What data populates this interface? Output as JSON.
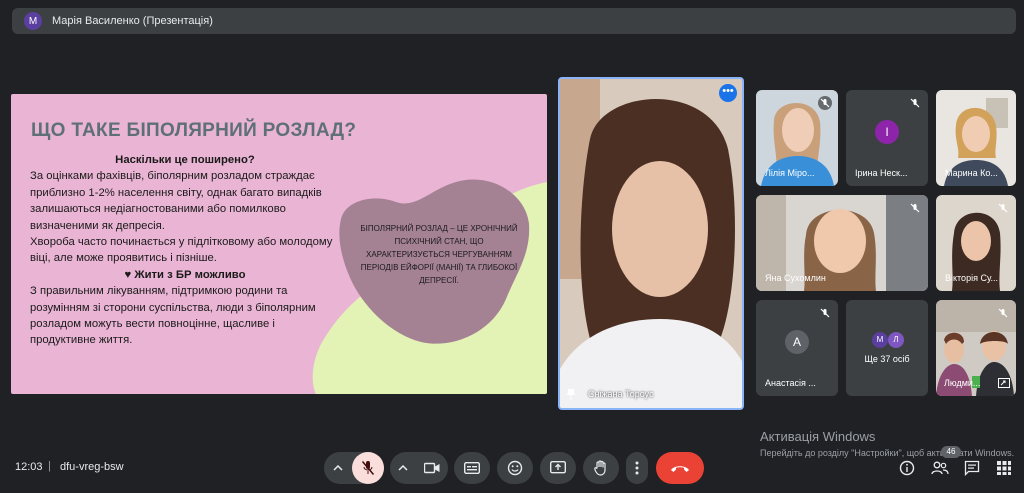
{
  "presenter": {
    "avatar_letter": "M",
    "title": "Марія Василенко (Презентація)"
  },
  "slide": {
    "title": "ЩО ТАКЕ БІПОЛЯРНИЙ РОЗЛАД?",
    "subtitle": "Наскільки це поширено?",
    "p1": "За оцінками фахівців, біполярним розладом страждає приблизно 1-2% населення світу, однак багато випадків залишаються недіагностованими або помилково визначеними як депресія.",
    "p2": "Хвороба часто починається у підлітковому або молодому віці, але може проявитись і пізніше.",
    "heading2": "♥ Жити з БР можливо",
    "p3": "З правильним лікуванням, підтримкою родини та розумінням зі сторони суспільства, люди з біполярним розладом можуть вести повноцінне, щасливе і продуктивне життя.",
    "blob_text": "Біполярний розлад – це хронічний психічний стан, що характеризується чергуванням періодів ейфорії (манії) та глибокої депресії."
  },
  "main_video": {
    "name": "Сніжана Тороус"
  },
  "tiles": {
    "t1": {
      "name": "Лілія Міро..."
    },
    "t2": {
      "name": "Ірина Неск...",
      "letter": "І"
    },
    "t3": {
      "name": "Марина Ко..."
    },
    "t4": {
      "name": "Яна Сухомлин"
    },
    "t5": {
      "name": "Вікторія Су..."
    },
    "t6": {
      "name": "Анастасія ...",
      "letter": "A"
    },
    "t7": {
      "name": "Ще 37 осіб",
      "letters": [
        "M",
        "Л"
      ]
    },
    "t8": {
      "name": "Людми..."
    }
  },
  "activation": {
    "title": "Активація Windows",
    "sub": "Перейдіть до розділу \"Настройки\", щоб активувати Windows."
  },
  "bottom": {
    "time": "12:03",
    "separator": "|",
    "meeting_code": "dfu-vreg-bsw",
    "people_count": "46"
  },
  "colors": {
    "accent": "#8ab4f8",
    "end_call": "#ea4335",
    "mic_off_bg": "#f9dedc",
    "slide_bg": "#eab5d4",
    "blob": "#a48294",
    "green_shape": "#e3f2b5"
  }
}
